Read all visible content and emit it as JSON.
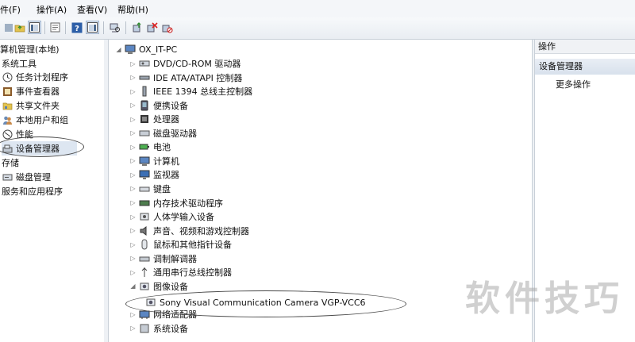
{
  "menu": [
    "文件(F)",
    "操作(A)",
    "查看(V)",
    "帮助(H)"
  ],
  "menu_partial_first": "件(F)",
  "left_tree": {
    "root": "算机管理(本地)",
    "system_tools": "系统工具",
    "items": [
      {
        "icon": "clock-icon",
        "label": "任务计划程序"
      },
      {
        "icon": "event-viewer-icon",
        "label": "事件查看器"
      },
      {
        "icon": "shared-folder-icon",
        "label": "共享文件夹"
      },
      {
        "icon": "users-icon",
        "label": "本地用户和组"
      },
      {
        "icon": "performance-icon",
        "label": "性能"
      },
      {
        "icon": "device-manager-icon",
        "label": "设备管理器"
      }
    ],
    "storage": "存储",
    "disk_management": "磁盘管理",
    "services": "服务和应用程序"
  },
  "device_tree": {
    "computer": "OX_IT-PC",
    "categories": [
      {
        "icon": "dvd-drive-icon",
        "label": "DVD/CD-ROM 驱动器"
      },
      {
        "icon": "ide-controller-icon",
        "label": "IDE ATA/ATAPI 控制器"
      },
      {
        "icon": "ieee1394-icon",
        "label": "IEEE 1394 总线主控制器"
      },
      {
        "icon": "portable-device-icon",
        "label": "便携设备"
      },
      {
        "icon": "processor-icon",
        "label": "处理器"
      },
      {
        "icon": "disk-drive-icon",
        "label": "磁盘驱动器"
      },
      {
        "icon": "battery-icon",
        "label": "电池"
      },
      {
        "icon": "computer-icon",
        "label": "计算机"
      },
      {
        "icon": "monitor-icon",
        "label": "监视器"
      },
      {
        "icon": "keyboard-icon",
        "label": "键盘"
      },
      {
        "icon": "memory-tech-icon",
        "label": "内存技术驱动程序"
      },
      {
        "icon": "hid-icon",
        "label": "人体学输入设备"
      },
      {
        "icon": "sound-icon",
        "label": "声音、视频和游戏控制器"
      },
      {
        "icon": "mouse-icon",
        "label": "鼠标和其他指针设备"
      },
      {
        "icon": "modem-icon",
        "label": "调制解调器"
      },
      {
        "icon": "usb-icon",
        "label": "通用串行总线控制器"
      },
      {
        "icon": "imaging-device-icon",
        "label": "图像设备",
        "expanded": true
      },
      {
        "icon": "network-adapter-icon",
        "label": "网络适配器"
      },
      {
        "icon": "system-devices-icon",
        "label": "系统设备"
      }
    ],
    "imaging_child": "Sony Visual Communication Camera VGP-VCC6"
  },
  "actions": {
    "header": "操作",
    "section": "设备管理器",
    "more": "更多操作"
  },
  "watermark": "软件技巧",
  "colors": {
    "selection_bg": "#dde6f1",
    "toolbar_bg": "#eef1f5"
  }
}
